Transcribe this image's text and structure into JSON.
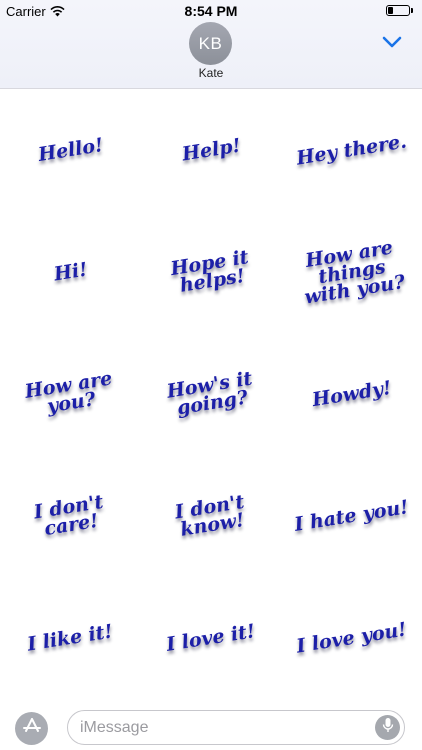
{
  "status_bar": {
    "carrier": "Carrier",
    "time": "8:54 PM"
  },
  "header": {
    "avatar_initials": "KB",
    "contact_name": "Kate",
    "collapse_icon": "chevron-down-icon",
    "accent_color": "#1a73e8"
  },
  "stickers": [
    {
      "text": "Hello!"
    },
    {
      "text": "Help!"
    },
    {
      "text": "Hey there."
    },
    {
      "text": "Hi!"
    },
    {
      "text": "Hope it helps!"
    },
    {
      "text": "How are things with you?"
    },
    {
      "text": "How are you?"
    },
    {
      "text": "How's it going?"
    },
    {
      "text": "Howdy!"
    },
    {
      "text": "I don't care!"
    },
    {
      "text": "I don't know!"
    },
    {
      "text": "I hate you!"
    },
    {
      "text": "I like it!"
    },
    {
      "text": "I love it!"
    },
    {
      "text": "I love you!"
    }
  ],
  "sticker_color": "#1c1fa8",
  "input_bar": {
    "placeholder": "iMessage",
    "value": "",
    "apps_icon": "app-store-icon",
    "mic_icon": "microphone-icon"
  }
}
